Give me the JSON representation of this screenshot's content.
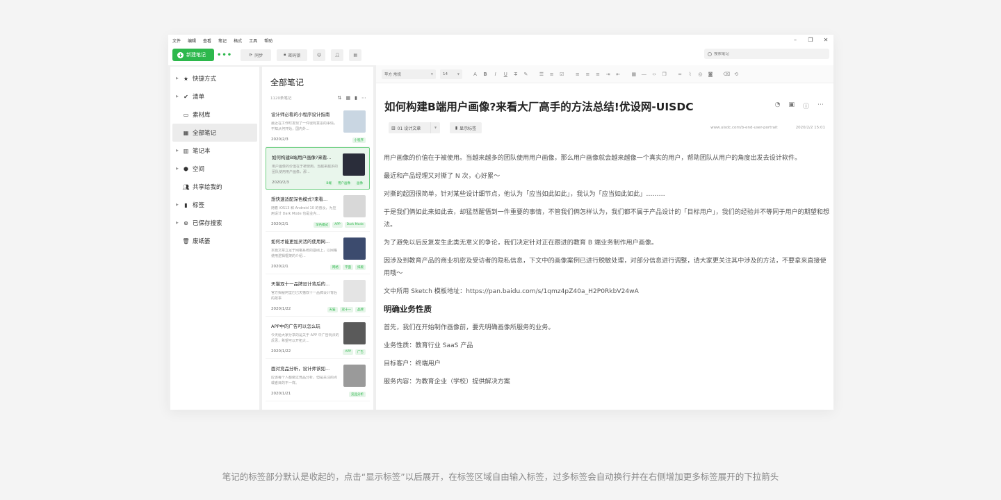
{
  "menu": [
    "文件",
    "编辑",
    "查看",
    "笔记",
    "格式",
    "工具",
    "帮助"
  ],
  "window_controls": [
    "–",
    "❐",
    "✕"
  ],
  "toolbar": {
    "new_note": "新建笔记",
    "more": "•••",
    "sync": "同步",
    "lock": "密码锁",
    "search_placeholder": "搜索笔记"
  },
  "sidebar": {
    "items": [
      {
        "label": "快捷方式",
        "icon": "star-icon",
        "expandable": true
      },
      {
        "label": "清单",
        "icon": "check-circle-icon",
        "expandable": true
      },
      {
        "label": "素材库",
        "icon": "archive-icon",
        "expandable": false
      },
      {
        "label": "全部笔记",
        "icon": "notes-icon",
        "expandable": false,
        "active": true
      },
      {
        "label": "笔记本",
        "icon": "notebook-icon",
        "expandable": true
      },
      {
        "label": "空间",
        "icon": "cube-icon",
        "expandable": true
      },
      {
        "label": "共享给我的",
        "icon": "people-icon",
        "expandable": false
      },
      {
        "label": "标签",
        "icon": "bookmark-icon",
        "expandable": true
      },
      {
        "label": "已保存搜索",
        "icon": "saved-search-icon",
        "expandable": true
      },
      {
        "label": "废纸篓",
        "icon": "trash-icon",
        "expandable": false
      }
    ]
  },
  "notelist": {
    "title": "全部笔记",
    "count": "1120条笔记",
    "notes": [
      {
        "title": "设计师必看的小程序设计指南",
        "snippet": "最近在工作时发现了一件很有意思的事情，不知从何开始，国内外...",
        "date": "2020/2/3",
        "tags": [
          "小程序"
        ],
        "thumb": "#c9d6e2"
      },
      {
        "title": "如何构建B端用户画像?来看...",
        "snippet": "用户画像的价值在于被使用。当越来越多的团队使用用户画像，那...",
        "date": "2020/2/3",
        "tags": [
          "B端",
          "用户画像",
          "画像"
        ],
        "thumb": "#2a2d3a",
        "selected": true
      },
      {
        "title": "想快速适配深色模式?来看...",
        "snippet": "随着 iOS13 和 Android 10 的普及，为应用设计 Dark Mode 也是业内...",
        "date": "2020/2/1",
        "tags": [
          "深色模式",
          "APP",
          "Dark Mode"
        ],
        "thumb": "#d8d8d8"
      },
      {
        "title": "如何才能更加灵活的使用网...",
        "snippet": "本篇文章立足于网格系统的基础上，以网格使用逻辑框架的介绍...",
        "date": "2020/2/1",
        "tags": [
          "网格",
          "平面",
          "排版"
        ],
        "thumb": "#3c4b6e"
      },
      {
        "title": "天猫双十一品牌设计背后的...",
        "snippet": "官方揭秘阿里巴巴天猫双十一品牌设计背后的故事",
        "date": "2020/1/22",
        "tags": [
          "天猫",
          "双十一",
          "品牌"
        ],
        "thumb": "#e4e4e4"
      },
      {
        "title": "APP中的广告可以怎么玩",
        "snippet": "今天给大家分享的是关于 APP 中广告玩法的反思，希望可以开拓大...",
        "date": "2020/1/22",
        "tags": [
          "APP",
          "广告"
        ],
        "thumb": "#5a5a5a"
      },
      {
        "title": "面对竞品分析，设计师该如...",
        "snippet": "应该每个人都做过竞品分析，但是关注的点或者目的不一样。",
        "date": "2020/1/21",
        "tags": [
          "竞品分析"
        ],
        "thumb": "#9a9a9a"
      }
    ]
  },
  "editor": {
    "font_family": "苹方 常规",
    "font_size": "14",
    "title": "如何构建B端用户画像?来看大厂高手的方法总结!优设网-UISDC",
    "notebook": "01 设计文章",
    "show_tags": "显示标签",
    "url": "www.uisdc.com/b-end-user-portrait",
    "datetime": "2020/2/2 15:01",
    "body": [
      {
        "type": "p",
        "text": "用户画像的价值在于被使用。当越来越多的团队使用用户画像，那么用户画像就会越来越像一个真实的用户，帮助团队从用户的角度出发去设计软件。"
      },
      {
        "type": "p",
        "text": "最近和产品经理又对撕了 N 次，心好累～"
      },
      {
        "type": "p",
        "text": "对撕的起因很简单，针对某些设计细节点，他认为「应当如此如此」，我认为「应当如此如此」………"
      },
      {
        "type": "p",
        "text": "于是我们俩如此来如此去，却猛然醒悟到一件重要的事情，不管我们俩怎样认为，我们都不属于产品设计的「目标用户」，我们的经验并不等同于用户的期望和想法。"
      },
      {
        "type": "p",
        "text": "为了避免以后反复发生此类无意义的争论，我们决定针对正在跟进的教育 B 端业务制作用户画像。"
      },
      {
        "type": "p",
        "text": "因涉及到教育产品的商业机密及受访者的隐私信息，下文中的画像案例已进行脱敏处理，对部分信息进行调整，请大家更关注其中涉及的方法，不要拿来直接使用哦～"
      },
      {
        "type": "p",
        "text": "文中所用 Sketch 模板地址：https://pan.baidu.com/s/1qmz4pZ40a_H2P0RkbV24wA"
      },
      {
        "type": "h3",
        "text": "明确业务性质"
      },
      {
        "type": "p",
        "text": "首先，我们在开始制作画像前，要先明确画像所服务的业务。"
      },
      {
        "type": "p",
        "text": "业务性质：教育行业 SaaS 产品"
      },
      {
        "type": "p",
        "text": "目标客户：终端用户"
      },
      {
        "type": "p",
        "text": "服务内容：为教育企业（学校）提供解决方案"
      }
    ]
  },
  "caption": "笔记的标签部分默认是收起的，点击“显示标签”以后展开，在标签区域自由输入标签，过多标签会自动换行并在右侧增加更多标签展开的下拉箭头",
  "colors": {
    "accent": "#2db84c",
    "selected_bg": "#e9f6ec",
    "selected_border": "#6ccf80"
  }
}
